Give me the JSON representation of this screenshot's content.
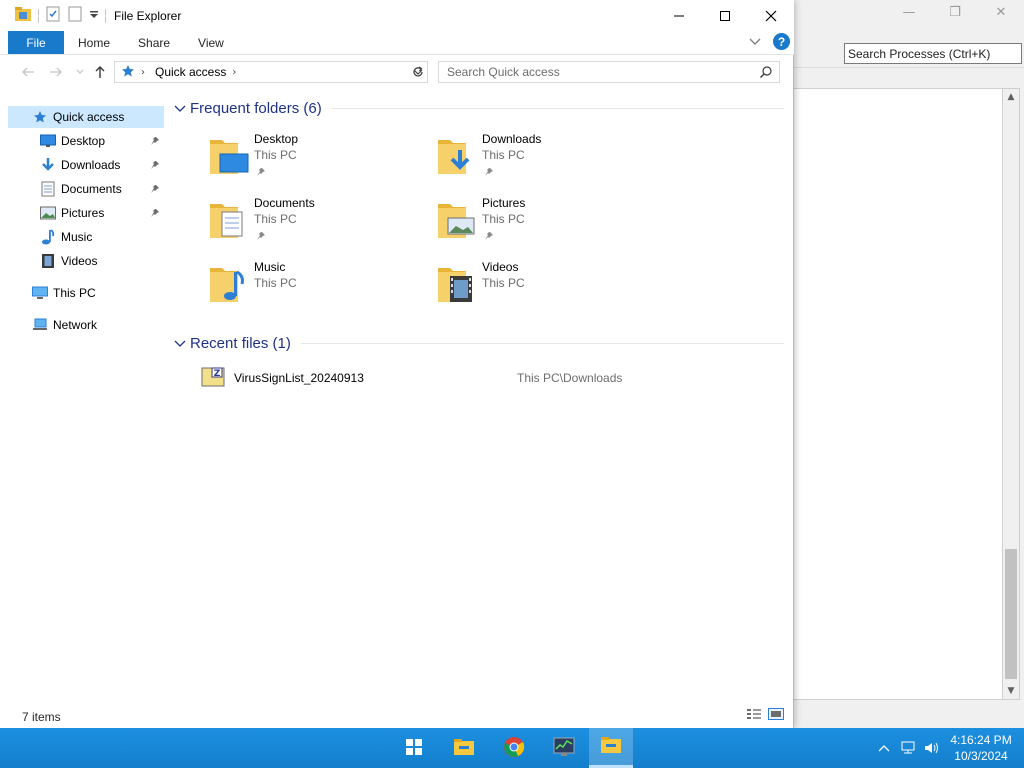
{
  "explorer": {
    "title": "File Explorer",
    "ribbon_tabs": [
      {
        "label": "File"
      },
      {
        "label": "Share"
      },
      {
        "label": "View"
      }
    ],
    "home_label": "Home",
    "address": {
      "crumb": "Quick access"
    },
    "search": {
      "placeholder": "Search Quick access"
    },
    "nav": {
      "quick_access": "Quick access",
      "items": [
        {
          "label": "Desktop",
          "icon": "desktop-icon",
          "pinned": true
        },
        {
          "label": "Downloads",
          "icon": "downloads-icon",
          "pinned": true
        },
        {
          "label": "Documents",
          "icon": "documents-icon",
          "pinned": true
        },
        {
          "label": "Pictures",
          "icon": "pictures-icon",
          "pinned": true
        },
        {
          "label": "Music",
          "icon": "music-icon",
          "pinned": false
        },
        {
          "label": "Videos",
          "icon": "videos-icon",
          "pinned": false
        }
      ],
      "this_pc": "This PC",
      "network": "Network"
    },
    "frequent": {
      "title": "Frequent folders (6)",
      "folders": [
        {
          "name": "Desktop",
          "location": "This PC",
          "pinned": true
        },
        {
          "name": "Downloads",
          "location": "This PC",
          "pinned": true
        },
        {
          "name": "Documents",
          "location": "This PC",
          "pinned": true
        },
        {
          "name": "Pictures",
          "location": "This PC",
          "pinned": true
        },
        {
          "name": "Music",
          "location": "This PC",
          "pinned": false
        },
        {
          "name": "Videos",
          "location": "This PC",
          "pinned": false
        }
      ]
    },
    "recent": {
      "title": "Recent files (1)",
      "files": [
        {
          "name": "VirusSignList_20240913",
          "location": "This PC\\Downloads"
        }
      ]
    },
    "status": {
      "count": "7 items"
    },
    "colors": {
      "accent": "#1979ca",
      "selected": "#cce8ff",
      "group_title": "#1e3287"
    }
  },
  "background_window": {
    "search_placeholder": "Search Processes (Ctrl+K)"
  },
  "taskbar": {
    "time": "4:16:24 PM",
    "date": "10/3/2024",
    "apps": [
      "start-icon",
      "file-explorer-icon",
      "chrome-icon",
      "process-explorer-icon",
      "file-explorer-active-icon"
    ]
  }
}
